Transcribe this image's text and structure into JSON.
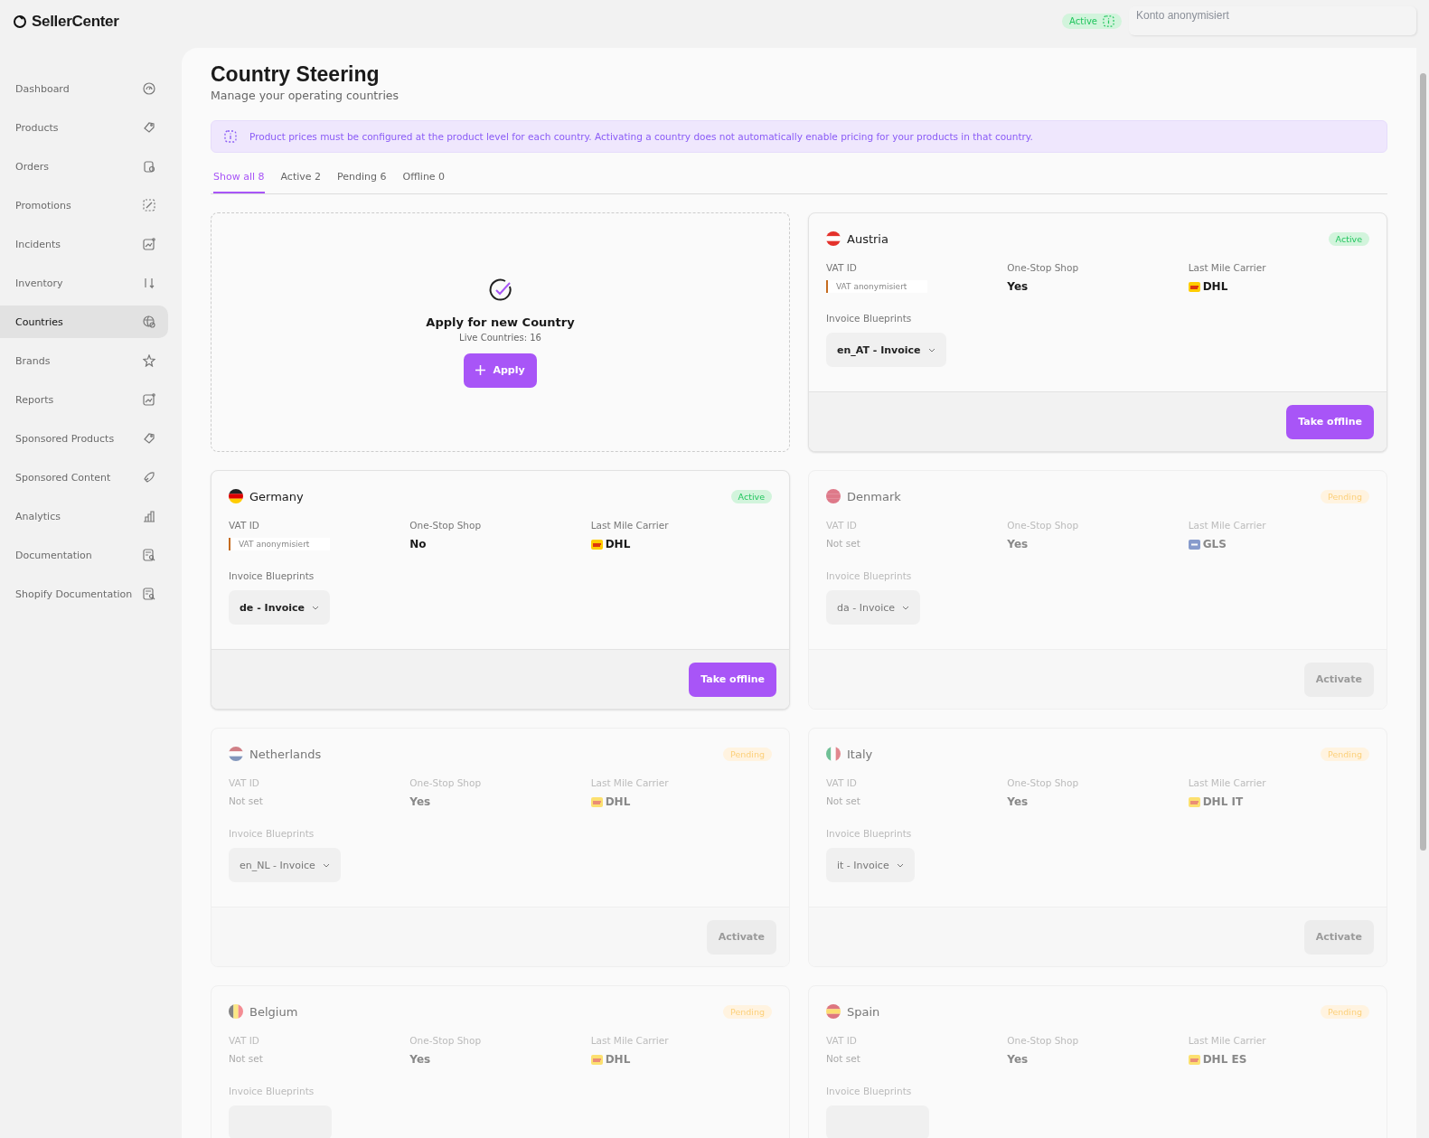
{
  "brand": {
    "name": "SellerCenter"
  },
  "header": {
    "status": {
      "label": "Active"
    },
    "account": {
      "placeholder": "Konto anonymisiert"
    }
  },
  "sidebar": {
    "items": [
      {
        "label": "Dashboard",
        "selected": false
      },
      {
        "label": "Products",
        "selected": false
      },
      {
        "label": "Orders",
        "selected": false
      },
      {
        "label": "Promotions",
        "selected": false
      },
      {
        "label": "Incidents",
        "selected": false
      },
      {
        "label": "Inventory",
        "selected": false
      },
      {
        "label": "Countries",
        "selected": true
      },
      {
        "label": "Brands",
        "selected": false
      },
      {
        "label": "Reports",
        "selected": false
      },
      {
        "label": "Sponsored Products",
        "selected": false
      },
      {
        "label": "Sponsored Content",
        "selected": false
      },
      {
        "label": "Analytics",
        "selected": false
      },
      {
        "label": "Documentation",
        "selected": false
      },
      {
        "label": "Shopify Documentation",
        "selected": false
      }
    ]
  },
  "page": {
    "title": "Country Steering",
    "subtitle": "Manage your operating countries",
    "notice": "Product prices must be configured at the product level for each country. Activating a country does not automatically enable pricing for your products in that country.",
    "tabs": [
      {
        "label": "Show all 8",
        "selected": true
      },
      {
        "label": "Active 2",
        "selected": false
      },
      {
        "label": "Pending 6",
        "selected": false
      },
      {
        "label": "Offline 0",
        "selected": false
      }
    ],
    "apply_card": {
      "title": "Apply for new Country",
      "subtitle": "Live Countries: 16",
      "button": "Apply"
    },
    "countries": [
      {
        "name": "Austria",
        "status": {
          "kind": "active",
          "label": "Active"
        },
        "vat_label": "VAT ID",
        "vat": {
          "kind": "field",
          "text": "VAT anonymisiert"
        },
        "oss_label": "One-Stop Shop",
        "oss": "Yes",
        "carrier_label": "Last Mile Carrier",
        "carrier": {
          "kind": "dhl",
          "name": "DHL"
        },
        "blueprints_label": "Invoice Blueprints",
        "blueprint": "en_AT - Invoice",
        "action": {
          "label": "Take offline",
          "disabled": false
        }
      },
      {
        "name": "Germany",
        "status": {
          "kind": "active",
          "label": "Active"
        },
        "vat_label": "VAT ID",
        "vat": {
          "kind": "field",
          "text": "VAT anonymisiert"
        },
        "oss_label": "One-Stop Shop",
        "oss": "No",
        "carrier_label": "Last Mile Carrier",
        "carrier": {
          "kind": "dhl",
          "name": "DHL"
        },
        "blueprints_label": "Invoice Blueprints",
        "blueprint": "de - Invoice",
        "action": {
          "label": "Take offline",
          "disabled": false
        }
      },
      {
        "name": "Denmark",
        "status": {
          "kind": "pending",
          "label": "Pending"
        },
        "vat_label": "VAT ID",
        "vat": {
          "kind": "text",
          "text": "Not set"
        },
        "oss_label": "One-Stop Shop",
        "oss": "Yes",
        "carrier_label": "Last Mile Carrier",
        "carrier": {
          "kind": "gls",
          "name": "GLS"
        },
        "blueprints_label": "Invoice Blueprints",
        "blueprint": "da - Invoice",
        "action": {
          "label": "Activate",
          "disabled": true
        }
      },
      {
        "name": "Netherlands",
        "status": {
          "kind": "pending",
          "label": "Pending"
        },
        "vat_label": "VAT ID",
        "vat": {
          "kind": "text",
          "text": "Not set"
        },
        "oss_label": "One-Stop Shop",
        "oss": "Yes",
        "carrier_label": "Last Mile Carrier",
        "carrier": {
          "kind": "dhl",
          "name": "DHL"
        },
        "blueprints_label": "Invoice Blueprints",
        "blueprint": "en_NL - Invoice",
        "action": {
          "label": "Activate",
          "disabled": true
        }
      },
      {
        "name": "Italy",
        "status": {
          "kind": "pending",
          "label": "Pending"
        },
        "vat_label": "VAT ID",
        "vat": {
          "kind": "text",
          "text": "Not set"
        },
        "oss_label": "One-Stop Shop",
        "oss": "Yes",
        "carrier_label": "Last Mile Carrier",
        "carrier": {
          "kind": "dhl",
          "name": "DHL IT"
        },
        "blueprints_label": "Invoice Blueprints",
        "blueprint": "it - Invoice",
        "action": {
          "label": "Activate",
          "disabled": true
        }
      },
      {
        "name": "Belgium",
        "status": {
          "kind": "pending",
          "label": "Pending"
        },
        "vat_label": "VAT ID",
        "vat": {
          "kind": "text",
          "text": "Not set"
        },
        "oss_label": "One-Stop Shop",
        "oss": "Yes",
        "carrier_label": "Last Mile Carrier",
        "carrier": {
          "kind": "dhl",
          "name": "DHL"
        },
        "blueprints_label": "Invoice Blueprints"
      },
      {
        "name": "Spain",
        "status": {
          "kind": "pending",
          "label": "Pending"
        },
        "vat_label": "VAT ID",
        "vat": {
          "kind": "text",
          "text": "Not set"
        },
        "oss_label": "One-Stop Shop",
        "oss": "Yes",
        "carrier_label": "Last Mile Carrier",
        "carrier": {
          "kind": "dhl",
          "name": "DHL ES"
        },
        "blueprints_label": "Invoice Blueprints"
      }
    ]
  }
}
